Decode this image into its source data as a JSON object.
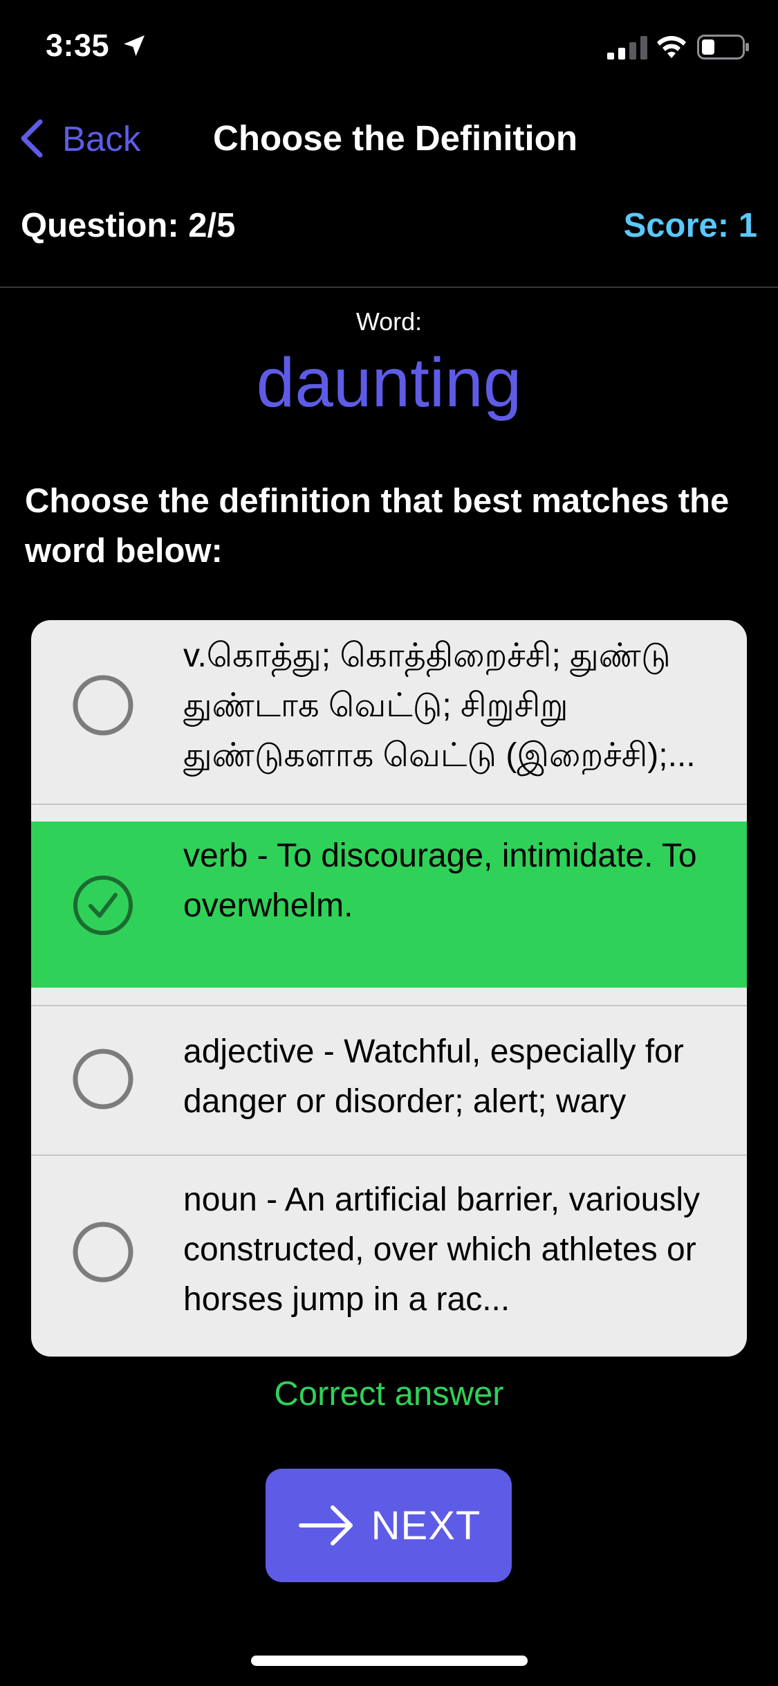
{
  "status_bar": {
    "time": "3:35",
    "icons": [
      "location-arrow-icon",
      "cellular-signal-icon",
      "wifi-icon",
      "battery-icon"
    ]
  },
  "nav": {
    "back_label": "Back",
    "title": "Choose the Definition"
  },
  "progress": {
    "question": "Question: 2/5",
    "score": "Score: 1"
  },
  "word": {
    "caption": "Word:",
    "value": "daunting"
  },
  "instruction": "Choose the definition that best matches the word below:",
  "options": [
    {
      "text": "v.கொத்து; கொத்திறைச்சி; துண்டு துண்டாக வெட்டு; சிறுசிறு துண்டுகளாக வெட்டு (இறைச்சி);...",
      "state": "unselected"
    },
    {
      "text": "verb -  To discourage, intimidate. To overwhelm.",
      "state": "correct"
    },
    {
      "text": "adjective -  Watchful, especially for danger or disorder; alert; wary",
      "state": "unselected"
    },
    {
      "text": "noun -  An artificial barrier, variously constructed, over which athletes or horses jump in a rac...",
      "state": "unselected"
    }
  ],
  "feedback": "Correct answer",
  "next_button": {
    "label": "NEXT",
    "icon": "arrow-right-icon"
  },
  "colors": {
    "accent": "#5e5ce6",
    "score": "#5ac8fa",
    "correct": "#30d158",
    "card": "#ececec",
    "background": "#000000"
  }
}
